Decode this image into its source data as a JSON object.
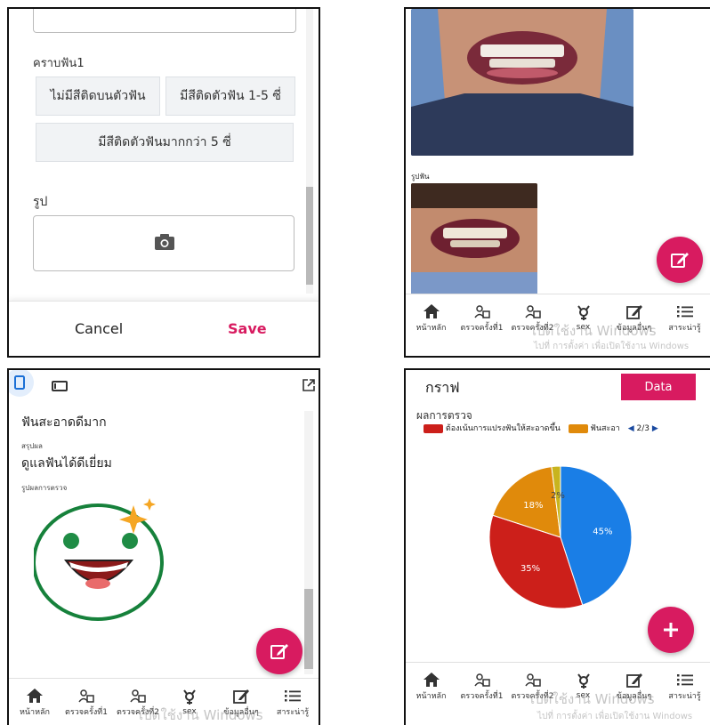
{
  "panel1": {
    "plaque_label": "คราบฟัน1",
    "chips": [
      "ไม่มีสีติดบนตัวฟัน",
      "มีสีติดตัวฟัน 1-5 ซี่",
      "มีสีติดตัวฟันมากกว่า 5 ซี่"
    ],
    "photo_label": "รูป",
    "cancel": "Cancel",
    "save": "Save"
  },
  "panel2": {
    "photo_caption": "รูปฟัน"
  },
  "nav": [
    "หน้าหลัก",
    "ตรวจครั้งที่1",
    "ตรวจครั้งที่2",
    "sex",
    "ข้อมูลอื่นๆ",
    "สาระน่ารู้"
  ],
  "watermark": {
    "line1": "เปิดใช้งาน Windows",
    "line2": "ไปที่ การตั้งค่า เพื่อเปิดใช้งาน Windows"
  },
  "panel3": {
    "heading": "ฟันสะอาดดีมาก",
    "summary_label": "สรุปผล",
    "summary_value": "ดูแลฟันได้ดีเยี่ยม",
    "image_label": "รูปผลการตรวจ"
  },
  "panel4": {
    "title": "กราฟ",
    "data_button": "Data",
    "pager": "2/3"
  },
  "colors": {
    "accent": "#d81b60",
    "blue": "#1a7ee6",
    "red": "#cc1f1a",
    "orange": "#e08a0b",
    "olive": "#c8b41e"
  },
  "chart_data": {
    "type": "pie",
    "title": "ผลการตรวจ",
    "legend": [
      "ต้องเน้นการแปรงฟันให้สะอาดขึ้น",
      "ฟันสะอา"
    ],
    "series": [
      {
        "name": "",
        "value": 45,
        "label": "45%",
        "color": "#1a7ee6"
      },
      {
        "name": "ต้องเน้นการแปรงฟันให้สะอาดขึ้น",
        "value": 35,
        "label": "35%",
        "color": "#cc1f1a"
      },
      {
        "name": "ฟันสะอา",
        "value": 18,
        "label": "18%",
        "color": "#e08a0b"
      },
      {
        "name": "",
        "value": 2,
        "label": "2%",
        "color": "#c8b41e"
      }
    ]
  }
}
